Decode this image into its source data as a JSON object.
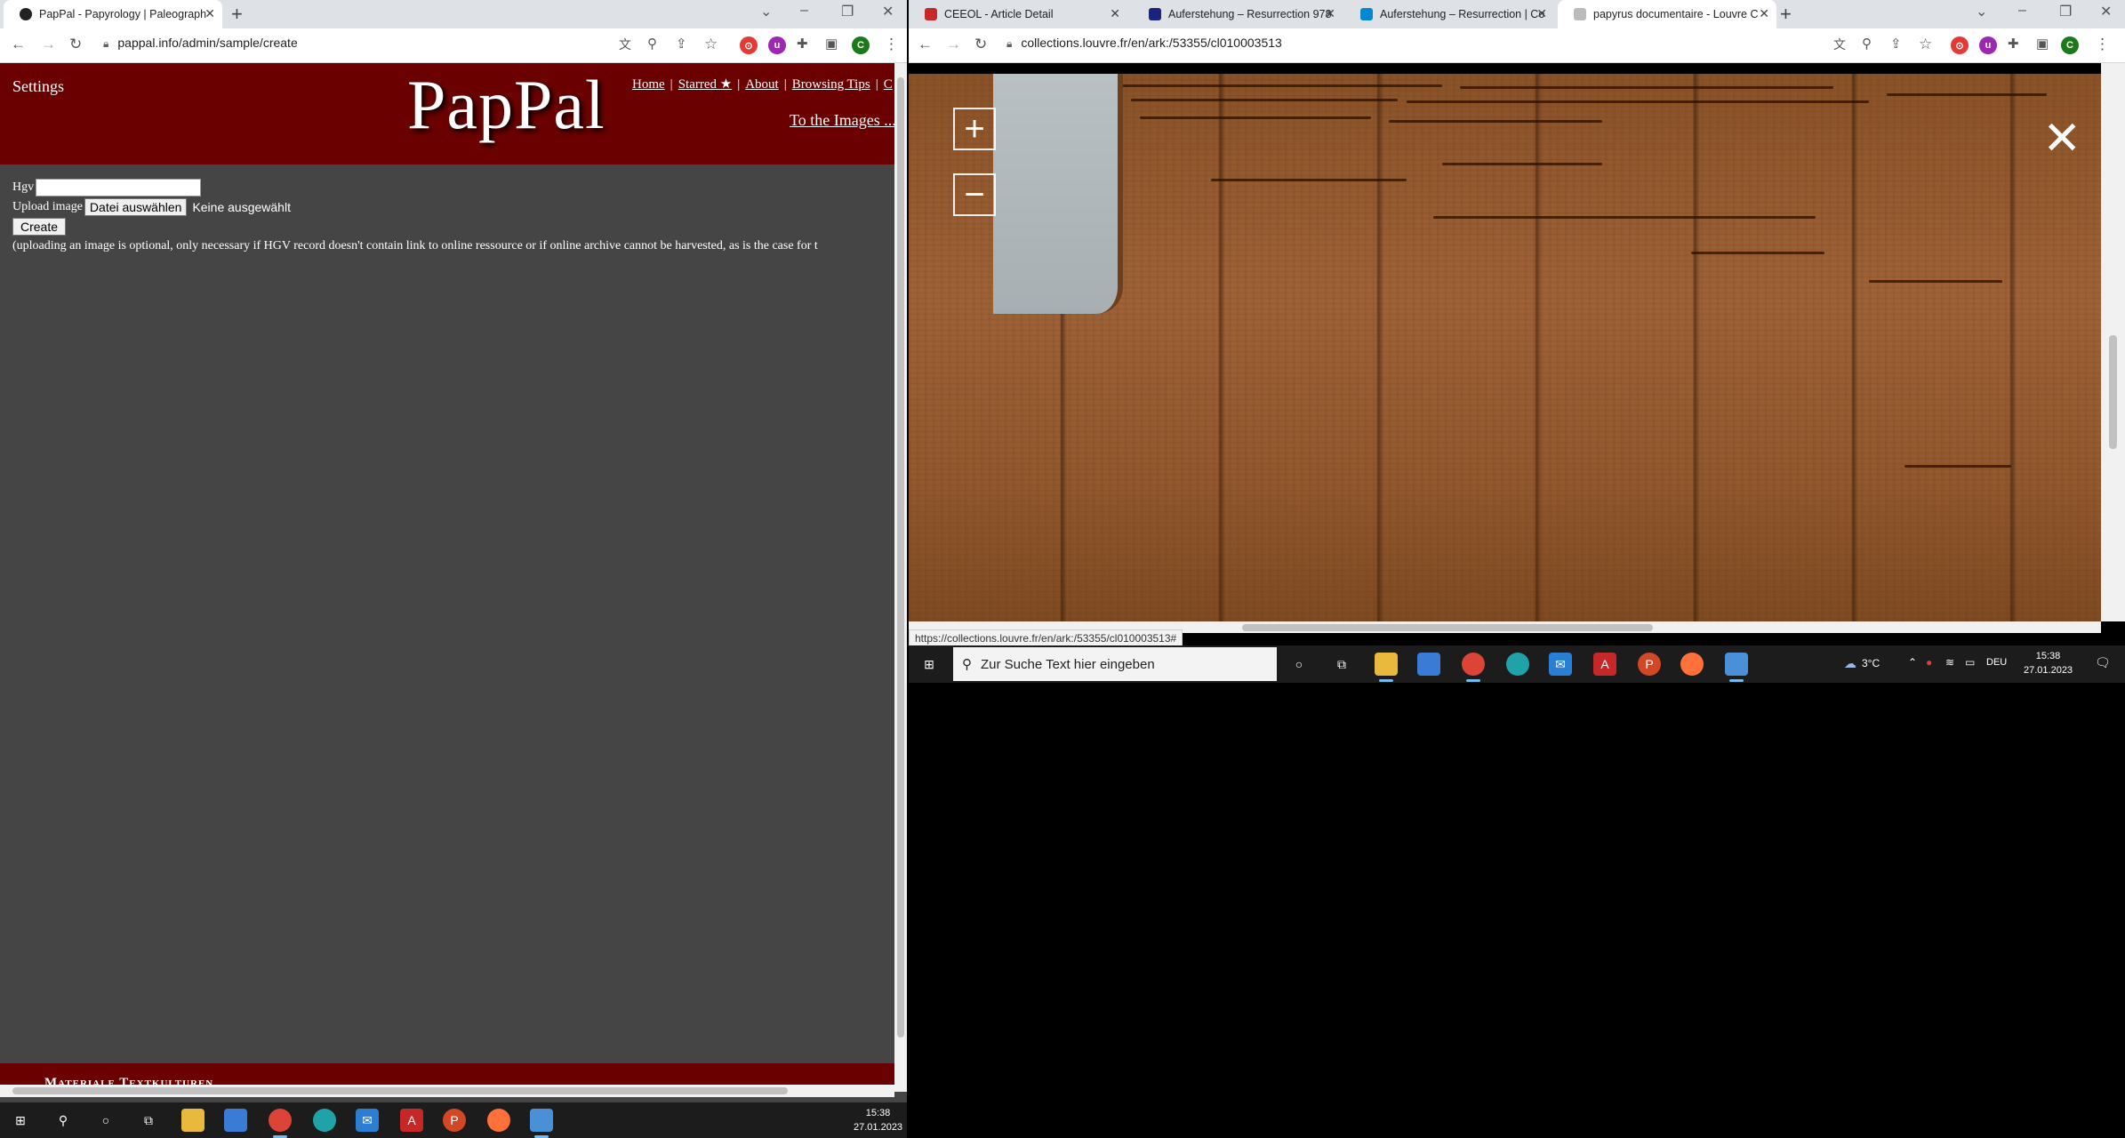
{
  "left_window": {
    "tabs": [
      {
        "title": "PapPal - Papyrology | Paleograph",
        "active": true
      }
    ],
    "address": "pappal.info/admin/sample/create",
    "page": {
      "settings": "Settings",
      "logo": "PapPal",
      "nav": [
        "Home",
        "Starred ★",
        "About",
        "Browsing Tips",
        "C"
      ],
      "to_images": "To the Images ...",
      "hgv_label": "Hgv",
      "upload_label": "Upload image",
      "file_button": "Datei auswählen",
      "no_file": "Keine ausgewählt",
      "create_button": "Create",
      "note": "(uploading an image is optional, only necessary if HGV record doesn't contain link to online ressource or if online archive cannot be harvested, as is the case for t",
      "footer": "Materiale Textkulturen"
    },
    "taskbar": {
      "time": "15:38",
      "date": "27.01.2023"
    }
  },
  "right_window": {
    "tabs": [
      {
        "title": "CEEOL - Article Detail",
        "active": false
      },
      {
        "title": "Auferstehung – Resurrection 978",
        "active": false
      },
      {
        "title": "Auferstehung – Resurrection | Co",
        "active": false
      },
      {
        "title": "papyrus documentaire - Louvre C",
        "active": true
      }
    ],
    "address": "collections.louvre.fr/en/ark:/53355/cl010003513",
    "status_url": "https://collections.louvre.fr/en/ark:/53355/cl010003513#",
    "viewer": {
      "zoom_in": "+",
      "zoom_out": "−",
      "close": "✕"
    },
    "taskbar": {
      "search_placeholder": "Zur Suche Text hier eingeben",
      "weather": "3°C",
      "lang": "DEU",
      "time": "15:38",
      "date": "27.01.2023"
    }
  },
  "colors": {
    "pappal_red": "#6b0000",
    "page_bg": "#454545",
    "papyrus": "#9a5e33"
  }
}
